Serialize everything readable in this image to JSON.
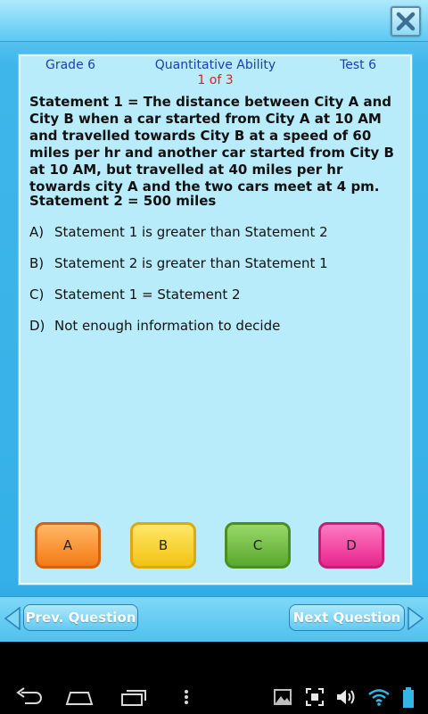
{
  "header": {
    "grade": "Grade 6",
    "subject": "Quantitative Ability",
    "test": "Test 6",
    "progress": "1 of 3"
  },
  "question": {
    "statement1": "Statement 1 = The distance between City A and City B when a car started from City A at 10 AM and travelled towards City B at a speed of 60 miles per hr and another car started from City B at 10 AM, but travelled at 40 miles per hr towards city A and the two cars meet at 4 pm.",
    "statement2": "Statement 2 = 500 miles",
    "options": [
      {
        "letter": "A)",
        "text": "Statement  1 is greater than Statement 2"
      },
      {
        "letter": "B)",
        "text": "Statement  2 is greater than Statement 1"
      },
      {
        "letter": "C)",
        "text": "Statement 1 = Statement 2"
      },
      {
        "letter": "D)",
        "text": "Not enough information to decide"
      }
    ]
  },
  "answers": [
    "A",
    "B",
    "C",
    "D"
  ],
  "navigation": {
    "prev_label": "Prev. Question",
    "next_label": "Next Question"
  },
  "colors": {
    "accent": "#35b0e8",
    "answer_a": "#f47a14",
    "answer_b": "#f2c314",
    "answer_c": "#5aa82e",
    "answer_d": "#e8268c",
    "progress_text": "#e01f1f"
  }
}
